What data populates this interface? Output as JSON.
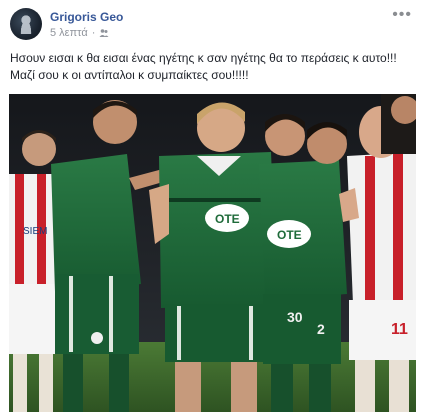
{
  "post": {
    "author": "Grigoris Geo",
    "timestamp": "5 λεπτά",
    "separator": "·",
    "privacy_icon": "friends-icon",
    "more_icon": "more-options-icon",
    "more_label": "•••",
    "text_lines": [
      "Ησουν εισαι κ θα εισαι ένας ηγέτης κ σαν ηγέτης θα το περάσεις κ αυτο!!!",
      "Μαζί σου κ οι αντίπαλοι κ συμπαίκτες σου!!!!!"
    ]
  },
  "photo": {
    "shirt_sponsor": "ΟΤΕ",
    "shirt_sponsor_2": "ΟΤΕ",
    "opponent_sponsor": "SIEM",
    "number_left": "30",
    "number_mid": "2",
    "number_right": "11",
    "colors": {
      "green_kit": "#1f6b3a",
      "red_kit": "#c8202a",
      "white_kit": "#f2f2f2",
      "pitch": "#3d6b2e"
    }
  },
  "colors": {
    "author_link": "#385898",
    "meta_text": "#90949c",
    "body_text": "#1d2129"
  }
}
